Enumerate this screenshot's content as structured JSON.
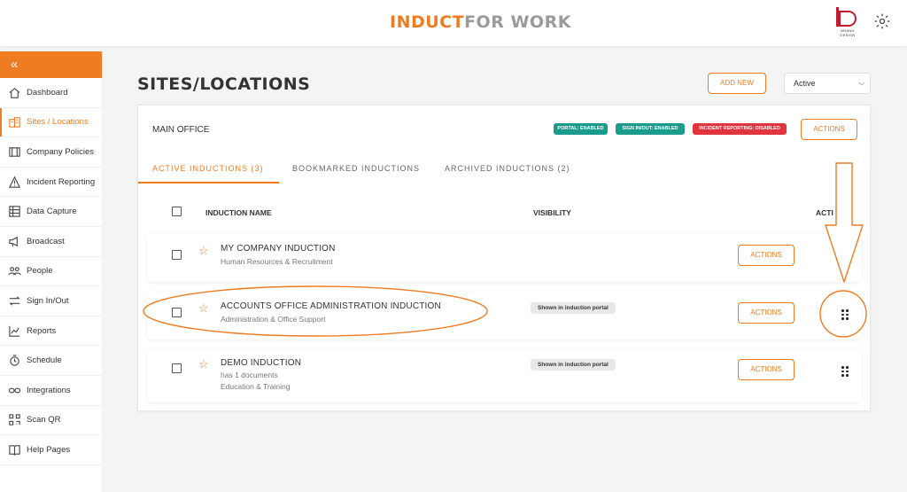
{
  "header": {
    "logo_part1": "INDUCT",
    "logo_part2": "FOR WORK",
    "brand_text": "BRAND DESIGN",
    "gear_icon": "gear-icon"
  },
  "sidebar": {
    "collapse_label": "«",
    "items": [
      {
        "label": "Dashboard",
        "icon": "home-icon"
      },
      {
        "label": "Sites / Locations",
        "icon": "building-icon"
      },
      {
        "label": "Company Policies",
        "icon": "book-icon"
      },
      {
        "label": "Incident Reporting",
        "icon": "warning-icon"
      },
      {
        "label": "Data Capture",
        "icon": "form-icon"
      },
      {
        "label": "Broadcast",
        "icon": "megaphone-icon"
      },
      {
        "label": "People",
        "icon": "people-icon"
      },
      {
        "label": "Sign In/Out",
        "icon": "swap-icon"
      },
      {
        "label": "Reports",
        "icon": "chart-icon"
      },
      {
        "label": "Schedule",
        "icon": "clock-icon"
      },
      {
        "label": "Integrations",
        "icon": "link-icon"
      },
      {
        "label": "Scan QR",
        "icon": "qr-icon"
      },
      {
        "label": "Help Pages",
        "icon": "help-book-icon"
      }
    ],
    "active_index": 1,
    "accent": "#f07c22"
  },
  "page": {
    "title": "SITES/LOCATIONS",
    "add_new": "ADD NEW",
    "status_filter": "Active"
  },
  "site": {
    "name": "MAIN OFFICE",
    "badges": {
      "portal": "PORTAL: ENABLED",
      "signin": "SIGN IN/OUT: ENABLED",
      "incident": "INCIDENT REPORTING: DISABLED"
    },
    "actions": "ACTIONS",
    "tabs": [
      "ACTIVE INDUCTIONS  (3)",
      "BOOKMARKED INDUCTIONS",
      "ARCHIVED INDUCTIONS  (2)"
    ]
  },
  "table": {
    "col_name": "INDUCTION NAME",
    "col_visibility": "VISIBILITY",
    "col_actions": "ACTI",
    "rows": [
      {
        "name": "MY COMPANY INDUCTION",
        "sub1": "Human Resources & Recruitment",
        "sub2": "",
        "visibility": "",
        "actions": "ACTIONS"
      },
      {
        "name": "ACCOUNTS OFFICE ADMINISTRATION INDUCTION",
        "sub1": "Administration & Office Support",
        "sub2": "",
        "visibility": "Shown in induction portal",
        "actions": "ACTIONS"
      },
      {
        "name": "DEMO INDUCTION",
        "sub1": "has 1 documents",
        "sub2": "Education & Training",
        "visibility": "Shown in induction portal",
        "actions": "ACTIONS"
      }
    ]
  },
  "colors": {
    "accent": "#f07c22",
    "teal": "#1a9b8c",
    "red": "#e0353f"
  }
}
